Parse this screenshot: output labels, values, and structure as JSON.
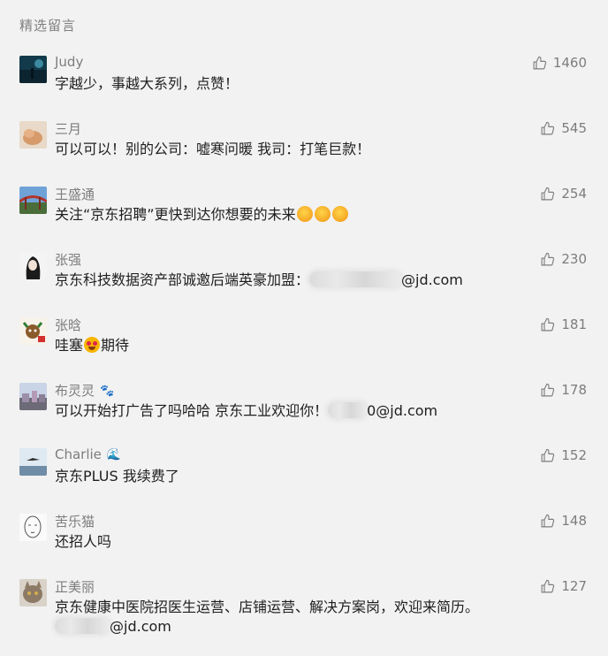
{
  "section_title": "精选留言",
  "comments": [
    {
      "name": "Judy",
      "likes": "1460",
      "avatar": "night-sky",
      "text": "字越少，事越大系列，点赞！"
    },
    {
      "name": "三月",
      "likes": "545",
      "avatar": "cat-sleeping",
      "text": "可以可以！别的公司：嘘寒问暖 我司：打笔巨款！"
    },
    {
      "name": "王盛通",
      "likes": "254",
      "avatar": "bridge",
      "text_before": "关注“京东招聘”更快到达你想要的未来",
      "emoji": "pray-emoji"
    },
    {
      "name": "张强",
      "likes": "230",
      "avatar": "anime-figure",
      "text_before": "京东科技数据资产部诚邀后端英豪加盟：",
      "text_after": "@jd.com"
    },
    {
      "name": "张晗",
      "likes": "181",
      "avatar": "christmas-character",
      "text_before": "哇塞",
      "emoji": "star-eyes-emoji",
      "text_after": "期待"
    },
    {
      "name": "布灵灵",
      "name_emoji": "paw-emoji",
      "likes": "178",
      "avatar": "town-view",
      "text_before": "可以开始打广告了吗哈哈 京东工业欢迎你！",
      "text_after": "0@jd.com"
    },
    {
      "name": "Charlie",
      "name_emoji": "wave-emoji",
      "likes": "152",
      "avatar": "bird-sky",
      "text": "京东PLUS 我续费了"
    },
    {
      "name": "苦乐猫",
      "likes": "148",
      "avatar": "sketch-face",
      "text": "还招人吗"
    },
    {
      "name": "正美丽",
      "likes": "127",
      "avatar": "tabby-cat",
      "text": "京东健康中医院招医生运营、店铺运营、解决方案岗，欢迎来简历。",
      "text_line2": "@jd.com"
    }
  ]
}
